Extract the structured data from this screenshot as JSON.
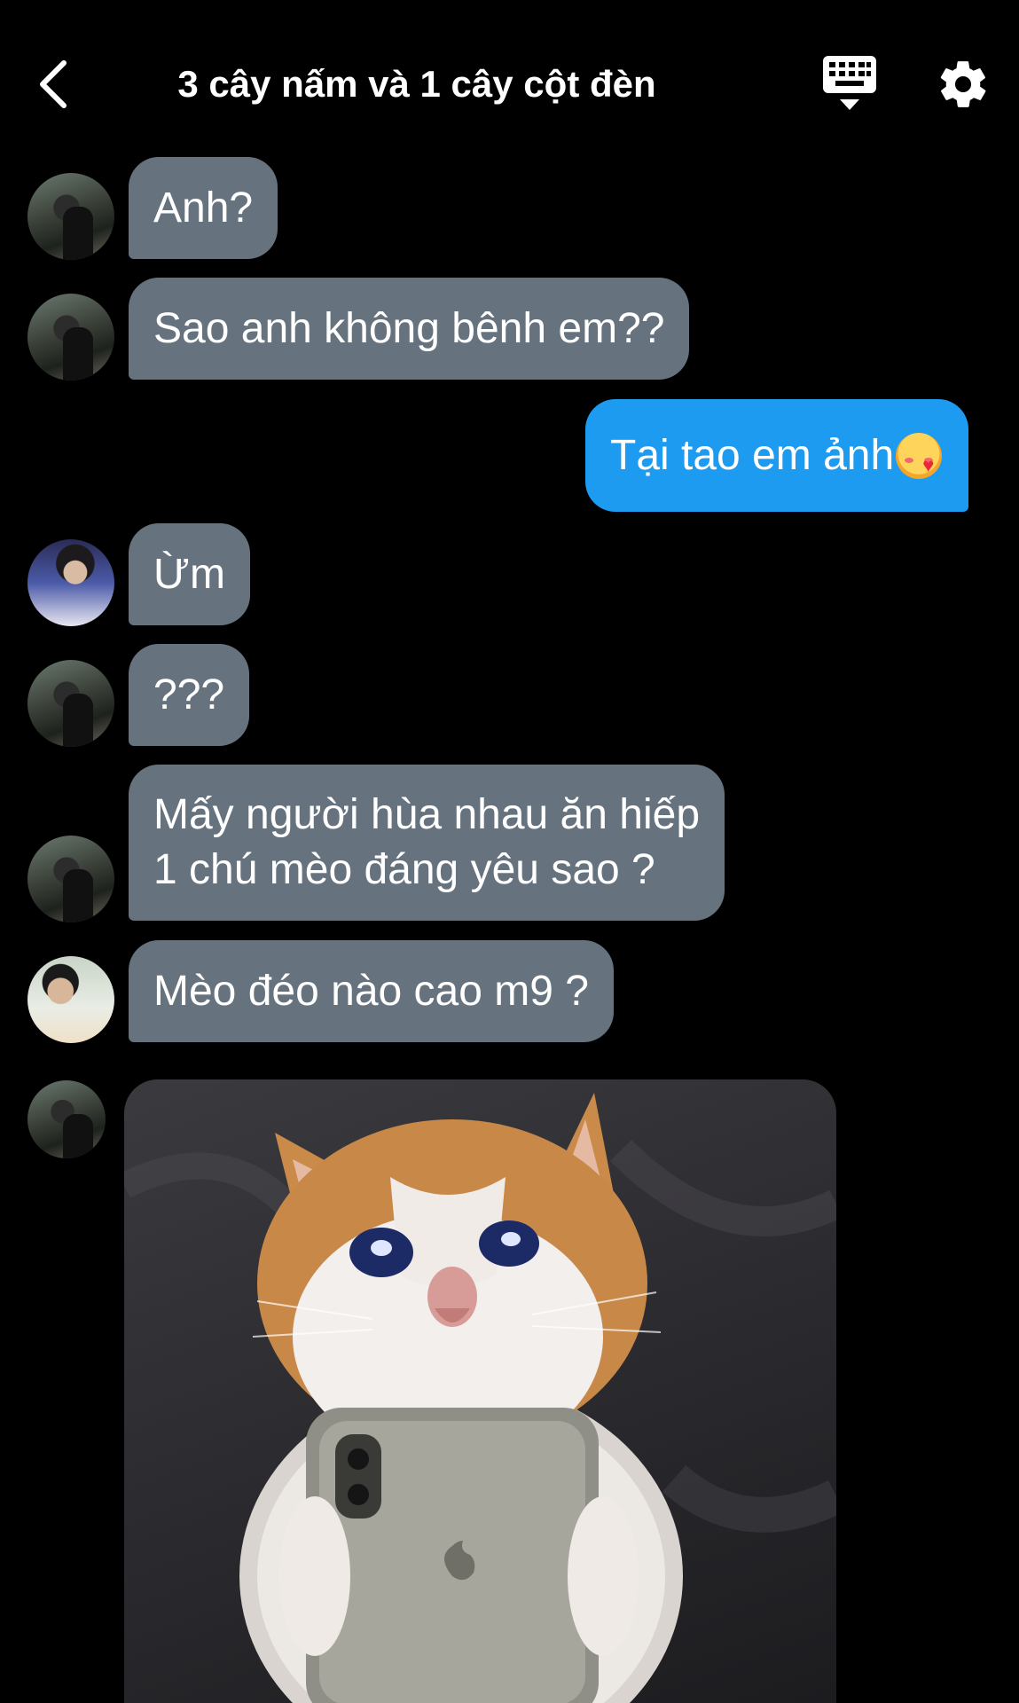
{
  "header": {
    "title": "3 cây nấm và 1 cây cột đèn",
    "back_icon": "chevron-left-icon",
    "keyboard_icon": "keyboard-icon",
    "settings_icon": "gear-icon"
  },
  "colors": {
    "background": "#000000",
    "incoming_bubble": "#66737f",
    "outgoing_bubble": "#1d9bf0",
    "text": "#ffffff"
  },
  "messages": [
    {
      "direction": "incoming",
      "text": "Anh?"
    },
    {
      "direction": "incoming",
      "text": "Sao anh không bênh em??"
    },
    {
      "direction": "outgoing",
      "text": "Tại tao em ảnh",
      "emoji": "smiling-face-with-hearts"
    },
    {
      "direction": "incoming",
      "text": "Ừm"
    },
    {
      "direction": "incoming",
      "text": "???"
    },
    {
      "direction": "incoming",
      "lines": [
        "Mấy người hùa nhau ăn hiếp",
        "1 chú mèo đáng yêu sao ?"
      ]
    },
    {
      "direction": "incoming",
      "text": "Mèo đéo nào cao m9 ?"
    },
    {
      "direction": "incoming",
      "type": "image",
      "image_subject": "crying-cat-holding-phone"
    }
  ]
}
